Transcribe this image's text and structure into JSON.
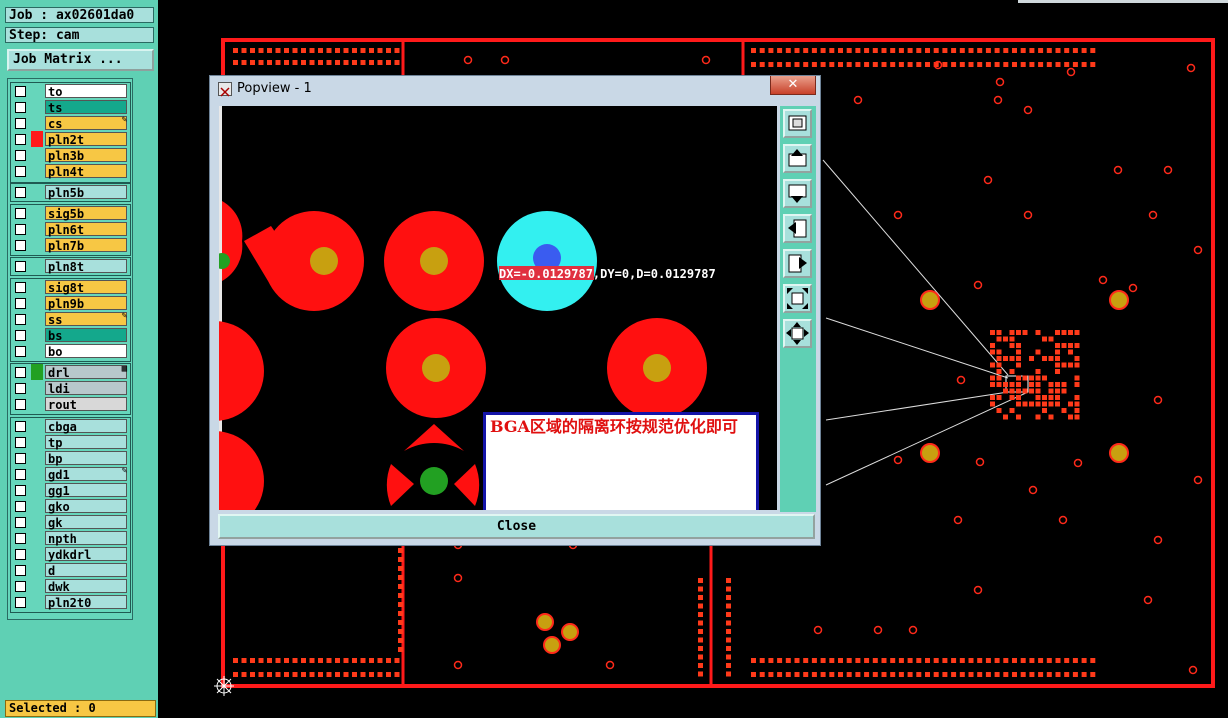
{
  "info": {
    "job": "Job : ax02601da0",
    "step": "Step: cam"
  },
  "job_matrix_label": "Job Matrix ...",
  "layers": [
    {
      "name": "to",
      "bg": "#ffffff"
    },
    {
      "name": "ts",
      "bg": "#14a88c"
    },
    {
      "name": "cs",
      "bg": "#f7c744",
      "icon": "✎"
    },
    {
      "name": "pln2t",
      "bg": "#f7c744",
      "active": "#ff1a1a"
    },
    {
      "name": "pln3b",
      "bg": "#f7c744"
    },
    {
      "name": "pln4t",
      "bg": "#f7c744"
    },
    {
      "name": "pln5b",
      "bg": "#a8e0dc"
    },
    {
      "name": "sig5b",
      "bg": "#f7c744"
    },
    {
      "name": "pln6t",
      "bg": "#f7c744"
    },
    {
      "name": "pln7b",
      "bg": "#f7c744"
    },
    {
      "name": "pln8t",
      "bg": "#a8e0dc"
    },
    {
      "name": "sig8t",
      "bg": "#f7c744"
    },
    {
      "name": "pln9b",
      "bg": "#f7c744"
    },
    {
      "name": "ss",
      "bg": "#f7c744",
      "icon": "✎"
    },
    {
      "name": "bs",
      "bg": "#14a88c"
    },
    {
      "name": "bo",
      "bg": "#ffffff"
    },
    {
      "name": "drl",
      "bg": "#b8c8cc",
      "active": "#22a022",
      "icon": "▦"
    },
    {
      "name": "ldi",
      "bg": "#b8c8cc"
    },
    {
      "name": "rout",
      "bg": "#d8d8d8"
    },
    {
      "name": "cbga",
      "bg": "#a8e0dc"
    },
    {
      "name": "tp",
      "bg": "#a8e0dc"
    },
    {
      "name": "bp",
      "bg": "#a8e0dc"
    },
    {
      "name": "gd1",
      "bg": "#a8e0dc",
      "icon": "✎"
    },
    {
      "name": "gg1",
      "bg": "#a8e0dc"
    },
    {
      "name": "gko",
      "bg": "#a8e0dc"
    },
    {
      "name": "gk",
      "bg": "#a8e0dc"
    },
    {
      "name": "npth",
      "bg": "#a8e0dc"
    },
    {
      "name": "ydkdrl",
      "bg": "#a8e0dc"
    },
    {
      "name": "d",
      "bg": "#a8e0dc"
    },
    {
      "name": "dwk",
      "bg": "#a8e0dc"
    },
    {
      "name": "pln2t0",
      "bg": "#a8e0dc"
    }
  ],
  "status": {
    "selected": "Selected : 0"
  },
  "popview": {
    "title": "Popview - 1",
    "close_x": "✕",
    "close_button": "Close",
    "measurement": "DX=-0.0129787,DY=0,D=0.0129787",
    "note": "BGA区域的隔离环按规范优化即可",
    "tools": [
      "zoom-fit-icon",
      "layer-up-icon",
      "layer-down-icon",
      "pan-left-icon",
      "pan-right-icon",
      "zoom-in-icon",
      "zoom-out-icon"
    ]
  },
  "colors": {
    "copper": "#ff1a1a",
    "pad_center": "#c8a010",
    "highlight": "#33f0f0",
    "via_green": "#22a022"
  }
}
